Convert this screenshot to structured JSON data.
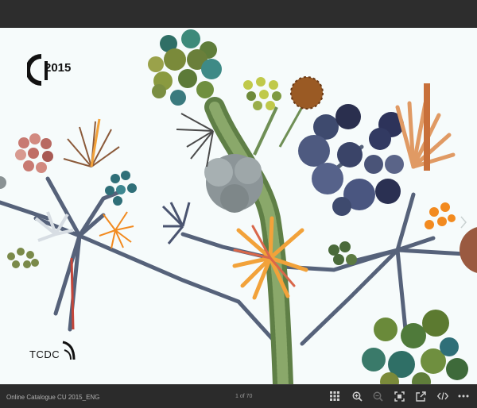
{
  "viewer": {
    "logo_year": "2015",
    "tcdc_label": "TCDC",
    "next_icon": "chevron-right-icon"
  },
  "bottombar": {
    "doc_title": "Online Catalogue CU 2015_ENG",
    "page_count": "1 of 70",
    "tools": [
      {
        "name": "grid-view-icon"
      },
      {
        "name": "zoom-in-icon"
      },
      {
        "name": "zoom-out-icon"
      },
      {
        "name": "fit-screen-icon"
      },
      {
        "name": "share-icon"
      },
      {
        "name": "embed-code-icon"
      },
      {
        "name": "more-options-icon"
      }
    ]
  },
  "colors": {
    "toolbar_bg": "#2b2b2b",
    "page_bg": "#f6fbfb",
    "stem_green": "#6f8f55",
    "branch_slate": "#56627a",
    "orange": "#f28a1f",
    "navy_sphere": "#3e4a6e",
    "teal_sphere": "#3a7a7e",
    "olive_sphere": "#7a8a3a"
  }
}
